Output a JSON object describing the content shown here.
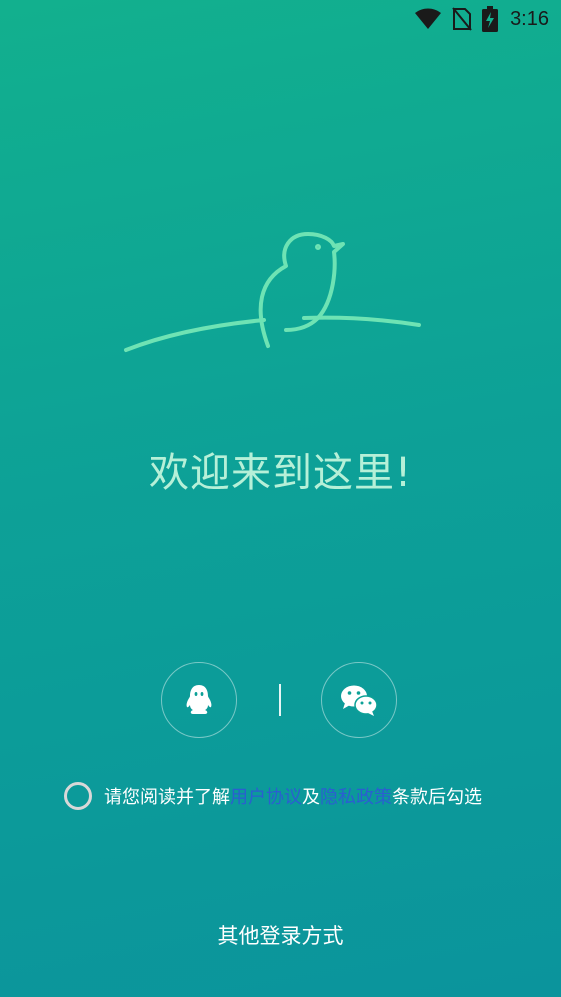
{
  "status_bar": {
    "time": "3:16",
    "icons": [
      "wifi-icon",
      "no-sim-icon",
      "battery-charging-icon"
    ]
  },
  "logo": {
    "icon": "bird-on-branch-logo"
  },
  "welcome_text": "欢迎来到这里!",
  "social_login": {
    "buttons": [
      {
        "icon": "qq-icon"
      },
      {
        "icon": "wechat-icon"
      }
    ]
  },
  "agreement": {
    "prefix": "请您阅读并了解",
    "user_agreement": "用户协议",
    "and": "及",
    "privacy_policy": "隐私政策",
    "suffix": "条款后勾选"
  },
  "other_login": "其他登录方式",
  "colors": {
    "gradient_top": "#12b08e",
    "gradient_bottom": "#0b949c",
    "accent_mint": "#6ee3b4",
    "link": "#2a5fd0",
    "welcome_text": "#b6f0d8"
  }
}
